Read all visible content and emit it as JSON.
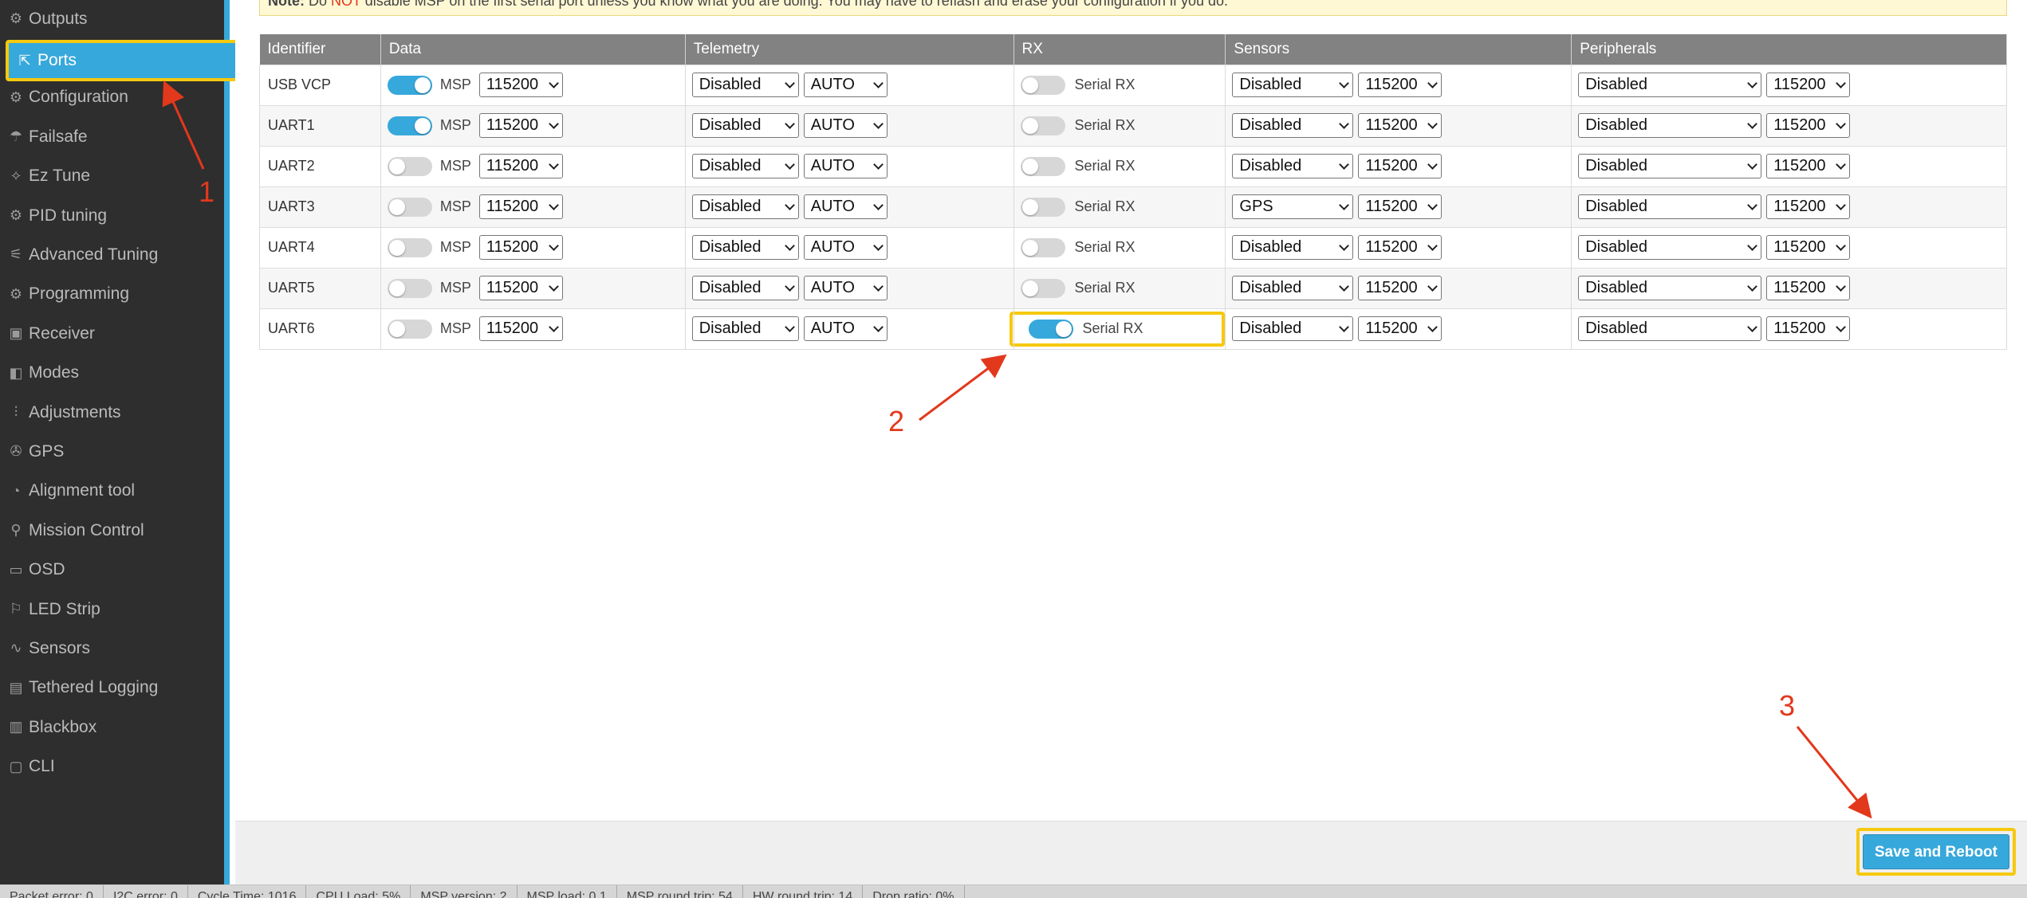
{
  "sidebar": {
    "items": [
      {
        "label": "Outputs",
        "icon": "outputs-icon",
        "glyph": "⚙"
      },
      {
        "label": "Ports",
        "icon": "ports-icon",
        "glyph": "⇱",
        "active": true
      },
      {
        "label": "Configuration",
        "icon": "gear-icon",
        "glyph": "⚙"
      },
      {
        "label": "Failsafe",
        "icon": "failsafe-icon",
        "glyph": "☂"
      },
      {
        "label": "Ez Tune",
        "icon": "wand-icon",
        "glyph": "✧"
      },
      {
        "label": "PID tuning",
        "icon": "pid-icon",
        "glyph": "⚙"
      },
      {
        "label": "Advanced Tuning",
        "icon": "advanced-icon",
        "glyph": "⚟"
      },
      {
        "label": "Programming",
        "icon": "programming-icon",
        "glyph": "⚙"
      },
      {
        "label": "Receiver",
        "icon": "receiver-icon",
        "glyph": "▣"
      },
      {
        "label": "Modes",
        "icon": "modes-icon",
        "glyph": "◧"
      },
      {
        "label": "Adjustments",
        "icon": "sliders-icon",
        "glyph": "⫶"
      },
      {
        "label": "GPS",
        "icon": "satellite-icon",
        "glyph": "✇"
      },
      {
        "label": "Alignment tool",
        "icon": "alignment-icon",
        "glyph": "◔"
      },
      {
        "label": "Mission Control",
        "icon": "map-pin-icon",
        "glyph": "⚲"
      },
      {
        "label": "OSD",
        "icon": "osd-icon",
        "glyph": "▭"
      },
      {
        "label": "LED Strip",
        "icon": "led-icon",
        "glyph": "⚐"
      },
      {
        "label": "Sensors",
        "icon": "pulse-icon",
        "glyph": "∿"
      },
      {
        "label": "Tethered Logging",
        "icon": "logging-icon",
        "glyph": "▤"
      },
      {
        "label": "Blackbox",
        "icon": "blackbox-icon",
        "glyph": "▥"
      },
      {
        "label": "CLI",
        "icon": "terminal-icon",
        "glyph": "▢"
      }
    ]
  },
  "note": {
    "bold": "Note:",
    "pre": " Do ",
    "red": "NOT",
    "post": " disable MSP on the first serial port unless you know what you are doing. You may have to reflash and erase your configuration if you do."
  },
  "table": {
    "headers": [
      "Identifier",
      "Data",
      "Telemetry",
      "RX",
      "Sensors",
      "Peripherals"
    ],
    "msp_label": "MSP",
    "serial_rx_label": "Serial RX",
    "rows": [
      {
        "id": "USB VCP",
        "msp": true,
        "data_baud": "115200",
        "telemetry": "Disabled",
        "tele_baud": "AUTO",
        "rx": false,
        "sensor": "Disabled",
        "sensor_baud": "115200",
        "peripheral": "Disabled",
        "peri_baud": "115200"
      },
      {
        "id": "UART1",
        "msp": true,
        "data_baud": "115200",
        "telemetry": "Disabled",
        "tele_baud": "AUTO",
        "rx": false,
        "sensor": "Disabled",
        "sensor_baud": "115200",
        "peripheral": "Disabled",
        "peri_baud": "115200"
      },
      {
        "id": "UART2",
        "msp": false,
        "data_baud": "115200",
        "telemetry": "Disabled",
        "tele_baud": "AUTO",
        "rx": false,
        "sensor": "Disabled",
        "sensor_baud": "115200",
        "peripheral": "Disabled",
        "peri_baud": "115200"
      },
      {
        "id": "UART3",
        "msp": false,
        "data_baud": "115200",
        "telemetry": "Disabled",
        "tele_baud": "AUTO",
        "rx": false,
        "sensor": "GPS",
        "sensor_baud": "115200",
        "peripheral": "Disabled",
        "peri_baud": "115200"
      },
      {
        "id": "UART4",
        "msp": false,
        "data_baud": "115200",
        "telemetry": "Disabled",
        "tele_baud": "AUTO",
        "rx": false,
        "sensor": "Disabled",
        "sensor_baud": "115200",
        "peripheral": "Disabled",
        "peri_baud": "115200"
      },
      {
        "id": "UART5",
        "msp": false,
        "data_baud": "115200",
        "telemetry": "Disabled",
        "tele_baud": "AUTO",
        "rx": false,
        "sensor": "Disabled",
        "sensor_baud": "115200",
        "peripheral": "Disabled",
        "peri_baud": "115200"
      },
      {
        "id": "UART6",
        "msp": false,
        "data_baud": "115200",
        "telemetry": "Disabled",
        "tele_baud": "AUTO",
        "rx": true,
        "sensor": "Disabled",
        "sensor_baud": "115200",
        "peripheral": "Disabled",
        "peri_baud": "115200"
      }
    ]
  },
  "footer": {
    "save_label": "Save and Reboot"
  },
  "status_bar": [
    "Packet error: 0",
    "I2C error: 0",
    "Cycle Time: 1016",
    "CPU Load: 5%",
    "MSP version: 2",
    "MSP load: 0.1",
    "MSP round trip: 54",
    "HW round trip: 14",
    "Drop ratio: 0%"
  ],
  "annotations": {
    "step1": "1",
    "step2": "2",
    "step3": "3",
    "color": "#e2381c",
    "highlight_color": "#f6c90e"
  },
  "colors": {
    "accent": "#37a8db",
    "sidebar_bg": "#2e2e2e",
    "header_bg": "#828282"
  }
}
